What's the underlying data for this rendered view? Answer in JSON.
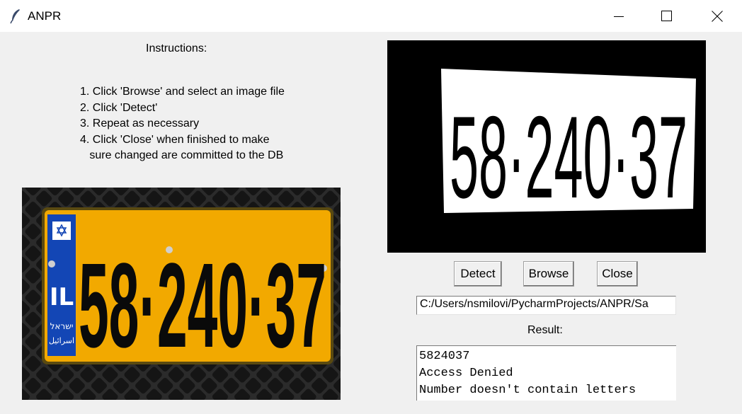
{
  "window": {
    "title": "ANPR",
    "icon": "feather-icon",
    "controls": [
      "minimize-icon",
      "maximize-icon",
      "close-icon"
    ]
  },
  "instructions": {
    "heading": "Instructions:",
    "steps": [
      "1. Click 'Browse' and select an image file",
      "2. Click 'Detect'",
      "3. Repeat as necessary",
      "4. Click 'Close' when finished to make",
      "   sure changed are committed to the DB"
    ]
  },
  "images": {
    "original_plate_text": "58·240·37",
    "original_plate_country": "IL",
    "original_plate_hebrew": "ישראל",
    "original_plate_arabic": "اسرائيل",
    "processed_plate_text": "58·240·37"
  },
  "buttons": {
    "detect": "Detect",
    "browse": "Browse",
    "close": "Close"
  },
  "file_path": {
    "value": "C:/Users/nsmilovi/PycharmProjects/ANPR/Sa"
  },
  "result": {
    "label": "Result:",
    "lines": [
      "5824037",
      "Access Denied",
      "Number doesn't contain letters"
    ]
  },
  "colors": {
    "plate_yellow": "#f2a900",
    "plate_blue": "#1346b5",
    "window_bg": "#f0f0f0"
  }
}
